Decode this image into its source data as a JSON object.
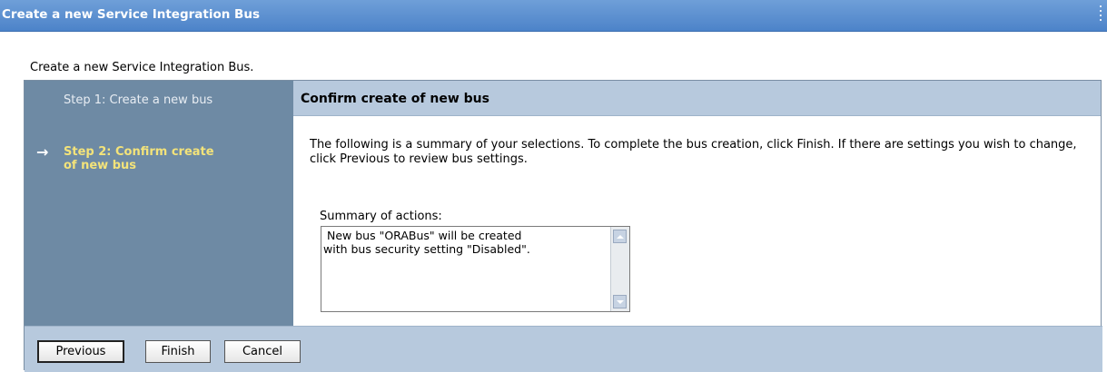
{
  "window": {
    "title": "Create a new Service Integration Bus"
  },
  "page": {
    "description": "Create a new Service Integration Bus."
  },
  "steps": [
    {
      "label": "Step 1: Create a new bus",
      "current": false
    },
    {
      "label": "Step 2: Confirm create of new bus",
      "current": true,
      "marker": "→"
    }
  ],
  "content": {
    "header": "Confirm create of new bus",
    "summary_text": "The following is a summary of your selections. To complete the bus creation, click Finish. If there are settings you wish to change, click Previous to review bus settings.",
    "summary_label": "Summary of actions:",
    "summary_box": " New bus \"ORABus\" will be created\nwith bus security setting \"Disabled\"."
  },
  "buttons": {
    "previous": "Previous",
    "finish": "Finish",
    "cancel": "Cancel"
  },
  "colors": {
    "titlebar": "#4c83c9",
    "steps_panel": "#6e8aa4",
    "current_step": "#f3e37a",
    "header_band": "#b7c9dd"
  }
}
